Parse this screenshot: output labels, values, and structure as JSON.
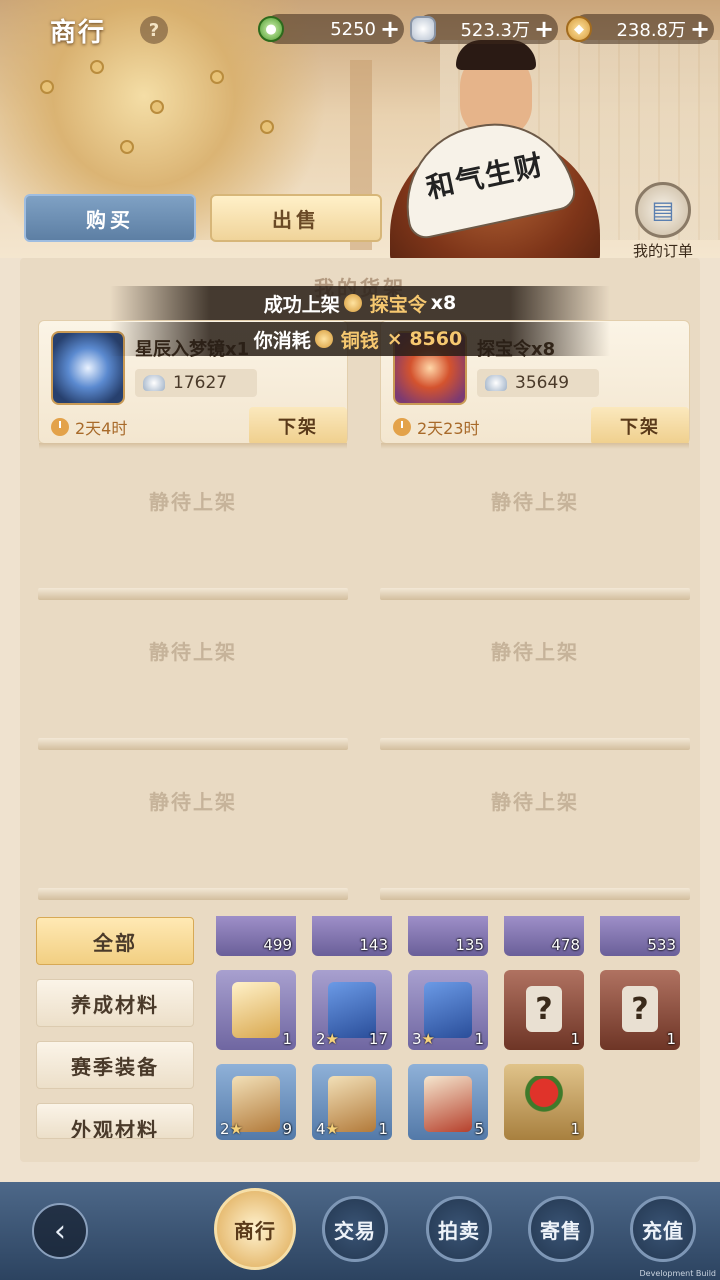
{
  "header": {
    "title": "商行",
    "help_label": "?"
  },
  "currencies": [
    {
      "icon": "jade-coin-icon",
      "value": "5250",
      "plus": "+"
    },
    {
      "icon": "silver-ingot-icon",
      "value": "523.3万",
      "plus": "+"
    },
    {
      "icon": "copper-coin-icon",
      "value": "238.8万",
      "plus": "+"
    }
  ],
  "merchant": {
    "fan_text": "和气生财"
  },
  "tabs": {
    "buy": "购买",
    "sell": "出售"
  },
  "orders": {
    "label": "我的订单"
  },
  "shelf": {
    "title": "我的货架",
    "listings": [
      {
        "name": "星辰入梦镜x1",
        "price": "17627",
        "time": "2天4时",
        "action": "下架"
      },
      {
        "name": "探宝令x8",
        "price": "35649",
        "time": "2天23时",
        "action": "下架"
      }
    ],
    "empty_label": "静待上架"
  },
  "toasts": {
    "line1_prefix": "成功上架",
    "line1_item": "探宝令",
    "line1_qty": "x8",
    "line2_prefix": "你消耗",
    "line2_item": "铜钱",
    "line2_qty": "× 8560"
  },
  "categories": [
    "全部",
    "养成材料",
    "赛季装备",
    "外观材料"
  ],
  "inventory": {
    "row1": [
      "499",
      "143",
      "135",
      "478",
      "533"
    ],
    "row2": [
      {
        "star": "",
        "count": "1"
      },
      {
        "star": "2",
        "count": "17"
      },
      {
        "star": "3",
        "count": "1"
      },
      {
        "star": "",
        "count": "1"
      },
      {
        "star": "",
        "count": "1"
      }
    ],
    "row3": [
      {
        "star": "2",
        "count": "9"
      },
      {
        "star": "4",
        "count": "1"
      },
      {
        "star": "",
        "count": "5"
      },
      {
        "star": "",
        "count": "1"
      }
    ]
  },
  "bottom_nav": {
    "back": "‹",
    "items": [
      "商行",
      "交易",
      "拍卖",
      "寄售",
      "充值"
    ]
  },
  "footer": {
    "dev_text": "Development Build"
  }
}
